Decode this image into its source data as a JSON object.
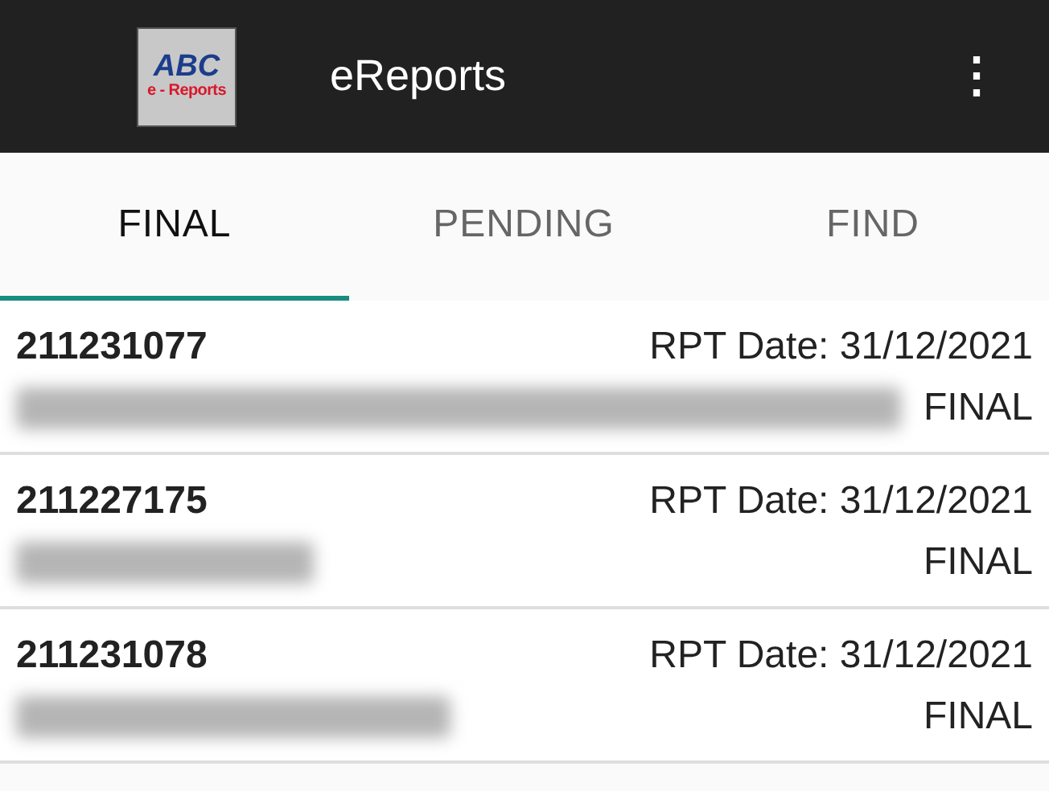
{
  "app_bar": {
    "logo": {
      "top": "ABC",
      "bottom": "e - Reports"
    },
    "title": "eReports",
    "menu": "⋮"
  },
  "tabs": [
    {
      "label": "FINAL",
      "selected": true
    },
    {
      "label": "PENDING",
      "selected": false
    },
    {
      "label": "FIND",
      "selected": false
    }
  ],
  "reports": [
    {
      "number": "211231077",
      "date": "RPT Date: 31/12/2021",
      "status": "FINAL"
    },
    {
      "number": "211227175",
      "date": "RPT Date: 31/12/2021",
      "status": "FINAL"
    },
    {
      "number": "211231078",
      "date": "RPT Date: 31/12/2021",
      "status": "FINAL"
    }
  ]
}
